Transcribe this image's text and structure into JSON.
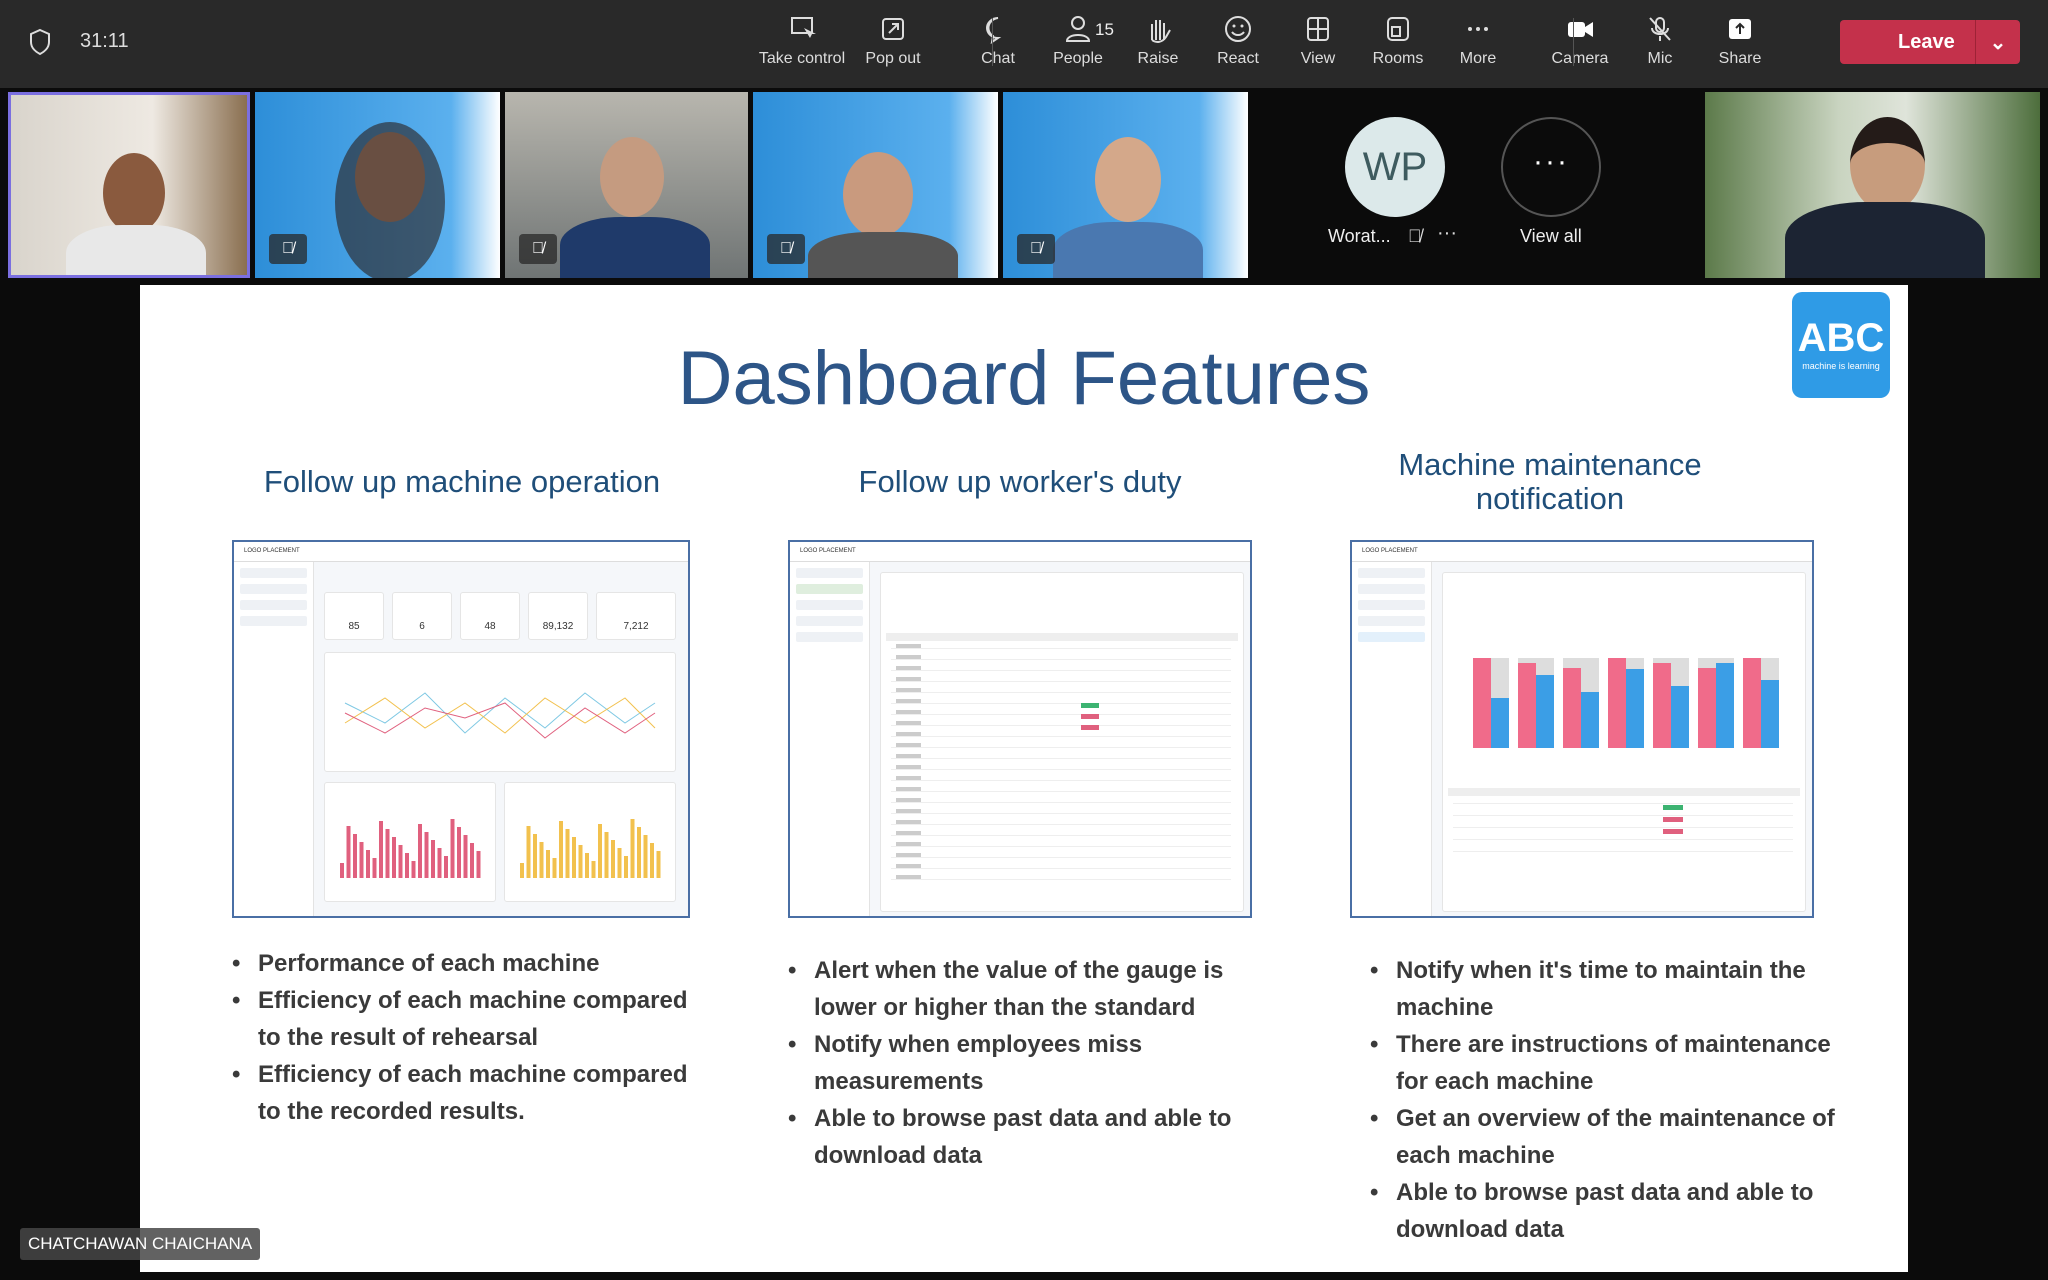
{
  "toolbar": {
    "timer": "31:11",
    "buttons": [
      {
        "label": "Take control",
        "icon": "take-control-icon"
      },
      {
        "label": "Pop out",
        "icon": "pop-out-icon"
      },
      {
        "label": "Chat",
        "icon": "chat-icon"
      },
      {
        "label": "People",
        "icon": "people-icon",
        "badge": "15"
      },
      {
        "label": "Raise",
        "icon": "hand-icon"
      },
      {
        "label": "React",
        "icon": "smile-icon"
      },
      {
        "label": "View",
        "icon": "view-icon"
      },
      {
        "label": "Rooms",
        "icon": "rooms-icon"
      },
      {
        "label": "More",
        "icon": "more-icon"
      },
      {
        "label": "Camera",
        "icon": "camera-icon"
      },
      {
        "label": "Mic",
        "icon": "mic-off-icon"
      },
      {
        "label": "Share",
        "icon": "share-icon"
      }
    ],
    "leave_label": "Leave",
    "leave_color": "#c4314b"
  },
  "participants": {
    "avatar_initials": "WP",
    "avatar_name": "Worat...",
    "view_all": "View all"
  },
  "speaker_name": "CHATCHAWAN CHAICHANA",
  "slide": {
    "title": "Dashboard Features",
    "logo_text": "ABC",
    "logo_sub": "machine is learning",
    "columns": [
      {
        "heading": "Follow up machine operation",
        "bullets": [
          "Performance of each machine",
          "Efficiency of each machine compared to the result of rehearsal",
          "Efficiency of each machine compared to the recorded results."
        ],
        "cards": [
          "85",
          "6",
          "48",
          "89,132",
          "7,212"
        ]
      },
      {
        "heading": "Follow up worker's duty",
        "bullets": [
          "Alert when the value of the gauge is lower or higher than the standard",
          "Notify when employees miss measurements",
          "Able to browse past data and able to download data"
        ]
      },
      {
        "heading": "Machine maintenance notification",
        "bullets": [
          "Notify when it's time to maintain the machine",
          "There are instructions of maintenance for each machine",
          "Get an overview of the maintenance of each machine",
          "Able to browse past data and able to download data"
        ]
      }
    ],
    "mini_header": "LOGO PLACEMENT"
  }
}
